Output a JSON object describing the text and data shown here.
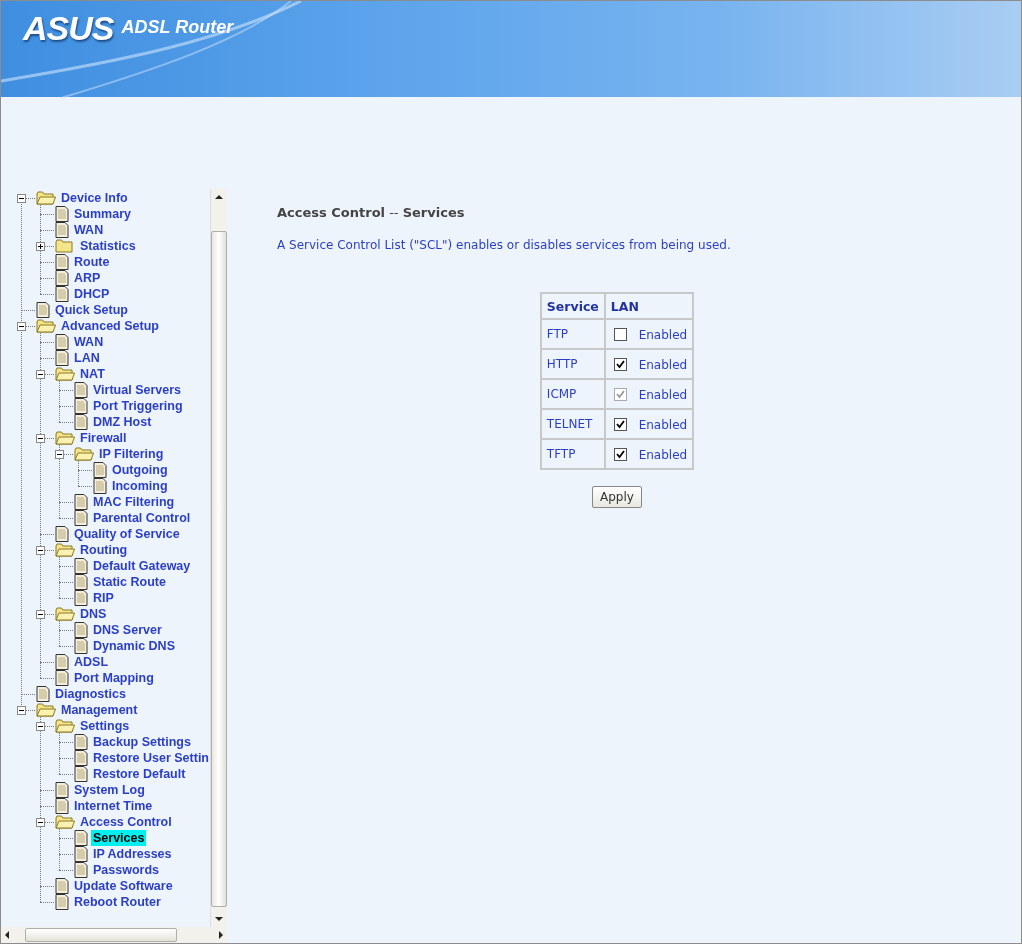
{
  "header": {
    "logo": "ASUS",
    "product": "ADSL Router"
  },
  "tree": [
    {
      "label": "Device Info",
      "kind": "folder",
      "expanded": true,
      "selected": false,
      "children": [
        {
          "label": "Summary",
          "kind": "page",
          "selected": false
        },
        {
          "label": "WAN",
          "kind": "page",
          "selected": false
        },
        {
          "label": "Statistics",
          "kind": "folder",
          "expanded": false,
          "selected": false
        },
        {
          "label": "Route",
          "kind": "page",
          "selected": false
        },
        {
          "label": "ARP",
          "kind": "page",
          "selected": false
        },
        {
          "label": "DHCP",
          "kind": "page",
          "selected": false
        }
      ]
    },
    {
      "label": "Quick Setup",
      "kind": "page",
      "selected": false
    },
    {
      "label": "Advanced Setup",
      "kind": "folder",
      "expanded": true,
      "selected": false,
      "children": [
        {
          "label": "WAN",
          "kind": "page",
          "selected": false
        },
        {
          "label": "LAN",
          "kind": "page",
          "selected": false
        },
        {
          "label": "NAT",
          "kind": "folder",
          "expanded": true,
          "selected": false,
          "children": [
            {
              "label": "Virtual Servers",
              "kind": "page",
              "selected": false
            },
            {
              "label": "Port Triggering",
              "kind": "page",
              "selected": false
            },
            {
              "label": "DMZ Host",
              "kind": "page",
              "selected": false
            }
          ]
        },
        {
          "label": "Firewall",
          "kind": "folder",
          "expanded": true,
          "selected": false,
          "children": [
            {
              "label": "IP Filtering",
              "kind": "folder",
              "expanded": true,
              "selected": false,
              "children": [
                {
                  "label": "Outgoing",
                  "kind": "page",
                  "selected": false
                },
                {
                  "label": "Incoming",
                  "kind": "page",
                  "selected": false
                }
              ]
            },
            {
              "label": "MAC Filtering",
              "kind": "page",
              "selected": false
            },
            {
              "label": "Parental Control",
              "kind": "page",
              "selected": false
            }
          ]
        },
        {
          "label": "Quality of Service",
          "kind": "page",
          "selected": false
        },
        {
          "label": "Routing",
          "kind": "folder",
          "expanded": true,
          "selected": false,
          "children": [
            {
              "label": "Default Gateway",
              "kind": "page",
              "selected": false
            },
            {
              "label": "Static Route",
              "kind": "page",
              "selected": false
            },
            {
              "label": "RIP",
              "kind": "page",
              "selected": false
            }
          ]
        },
        {
          "label": "DNS",
          "kind": "folder",
          "expanded": true,
          "selected": false,
          "children": [
            {
              "label": "DNS Server",
              "kind": "page",
              "selected": false
            },
            {
              "label": "Dynamic DNS",
              "kind": "page",
              "selected": false
            }
          ]
        },
        {
          "label": "ADSL",
          "kind": "page",
          "selected": false
        },
        {
          "label": "Port Mapping",
          "kind": "page",
          "selected": false
        }
      ]
    },
    {
      "label": "Diagnostics",
      "kind": "page",
      "selected": false
    },
    {
      "label": "Management",
      "kind": "folder",
      "expanded": true,
      "selected": false,
      "children": [
        {
          "label": "Settings",
          "kind": "folder",
          "expanded": true,
          "selected": false,
          "children": [
            {
              "label": "Backup Settings",
              "kind": "page",
              "selected": false
            },
            {
              "label": "Restore User Settin",
              "kind": "page",
              "selected": false
            },
            {
              "label": "Restore Default",
              "kind": "page",
              "selected": false
            }
          ]
        },
        {
          "label": "System Log",
          "kind": "page",
          "selected": false
        },
        {
          "label": "Internet Time",
          "kind": "page",
          "selected": false
        },
        {
          "label": "Access Control",
          "kind": "folder",
          "expanded": true,
          "selected": false,
          "children": [
            {
              "label": "Services",
              "kind": "page",
              "selected": true
            },
            {
              "label": "IP Addresses",
              "kind": "page",
              "selected": false
            },
            {
              "label": "Passwords",
              "kind": "page",
              "selected": false
            }
          ]
        },
        {
          "label": "Update Software",
          "kind": "page",
          "selected": false
        },
        {
          "label": "Reboot Router",
          "kind": "page",
          "selected": false
        }
      ]
    }
  ],
  "page_title": "**Access Control** -- **Services**",
  "description": "A Service Control List (\"SCL\") enables or disables services from being used.",
  "table": {
    "columns": [
      "Service",
      "LAN"
    ],
    "rows": [
      {
        "service": "FTP",
        "checked": false,
        "disabled": false,
        "label": "Enabled"
      },
      {
        "service": "HTTP",
        "checked": true,
        "disabled": false,
        "label": "Enabled"
      },
      {
        "service": "ICMP",
        "checked": true,
        "disabled": true,
        "label": "Enabled"
      },
      {
        "service": "TELNET",
        "checked": true,
        "disabled": false,
        "label": "Enabled"
      },
      {
        "service": "TFTP",
        "checked": true,
        "disabled": false,
        "label": "Enabled"
      }
    ]
  },
  "apply_button": "Apply"
}
